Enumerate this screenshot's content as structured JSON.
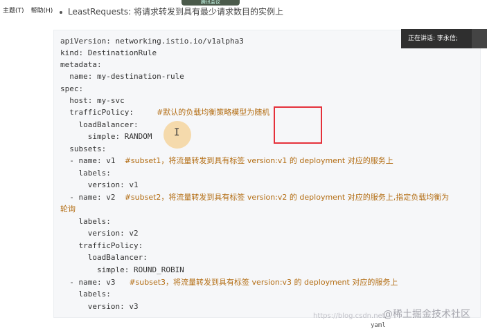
{
  "menu": {
    "theme": "主题(T)",
    "help": "帮助(H)"
  },
  "top_text": "LeastRequests: 将请求转发到具有最少请求数目的实例上",
  "meeting_tab": "腾讯会议",
  "speaking": "正在讲话: 李永信;",
  "code": {
    "lang": "yaml",
    "l1": {
      "text": "apiVersion: networking.istio.io/v1alpha3"
    },
    "l2": {
      "text": "kind: DestinationRule"
    },
    "l3": {
      "text": "metadata:"
    },
    "l4": {
      "text": "  name: my-destination-rule"
    },
    "l5": {
      "text": "spec:"
    },
    "l6": {
      "text": "  host: my-svc"
    },
    "l7": {
      "text": "  trafficPolicy:     ",
      "comment": "#默认的负载均衡策略模型为随机"
    },
    "l8": {
      "text": "    loadBalancer:"
    },
    "l9": {
      "text": "      simple: RANDOM"
    },
    "l10": {
      "text": "  subsets:"
    },
    "l11": {
      "text": "  - name: v1  ",
      "comment": "#subset1，将流量转发到具有标签 version:v1 的 deployment 对应的服务上"
    },
    "l12": {
      "text": "    labels:"
    },
    "l13": {
      "text": "      version: v1"
    },
    "l14": {
      "text": "  - name: v2  ",
      "comment": "#subset2，将流量转发到具有标签 version:v2 的 deployment 对应的服务上,指定负载均衡为"
    },
    "l15": {
      "comment": "轮询"
    },
    "l16": {
      "text": "    labels:"
    },
    "l17": {
      "text": "      version: v2"
    },
    "l18": {
      "text": "    trafficPolicy:"
    },
    "l19": {
      "text": "      loadBalancer:"
    },
    "l20": {
      "text": "        simple: ROUND_ROBIN"
    },
    "l21": {
      "text": "  - name: v3   ",
      "comment": "#subset3，将流量转发到具有标签 version:v3 的 deployment 对应的服务上"
    },
    "l22": {
      "text": "    labels:"
    },
    "l23": {
      "text": "      version: v3"
    }
  },
  "watermark": "https://blog.csdn.net/",
  "community": "@稀土掘金技术社区"
}
